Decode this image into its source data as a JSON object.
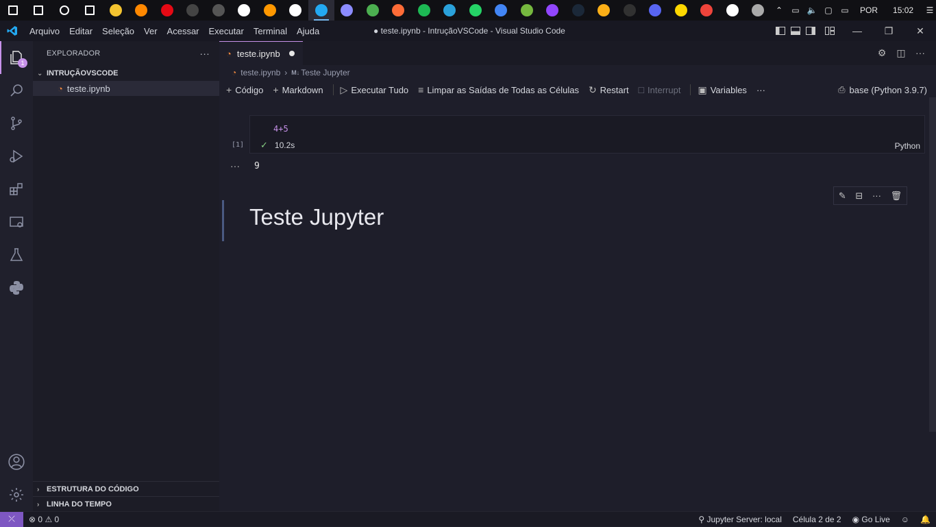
{
  "taskbar": {
    "apps": [
      {
        "name": "windows-start-icon",
        "color": "#ffffff"
      },
      {
        "name": "search-icon",
        "color": "#ffffff"
      },
      {
        "name": "cortana-icon",
        "color": "#ffffff"
      },
      {
        "name": "task-view-icon",
        "color": "#ffffff"
      },
      {
        "name": "file-explorer-icon",
        "color": "#f4c430"
      },
      {
        "name": "vlc-icon",
        "color": "#ff8800"
      },
      {
        "name": "netflix-icon",
        "color": "#e50914"
      },
      {
        "name": "terminal-icon",
        "color": "#444444"
      },
      {
        "name": "github-icon",
        "color": "#555555"
      },
      {
        "name": "pinwheel-icon",
        "color": "#ffffff"
      },
      {
        "name": "sublime-icon",
        "color": "#ff9800"
      },
      {
        "name": "notion-icon",
        "color": "#ffffff"
      },
      {
        "name": "vscode-icon",
        "color": "#23a9f2"
      },
      {
        "name": "app-icon",
        "color": "#8c8cff"
      },
      {
        "name": "shield-app-icon",
        "color": "#4caf50"
      },
      {
        "name": "postman-icon",
        "color": "#ff6c37"
      },
      {
        "name": "spotify-icon",
        "color": "#1db954"
      },
      {
        "name": "telegram-icon",
        "color": "#2aa1da"
      },
      {
        "name": "whatsapp-icon",
        "color": "#25d366"
      },
      {
        "name": "chrome-icon",
        "color": "#4285f4"
      },
      {
        "name": "utorrent-icon",
        "color": "#76b83f"
      },
      {
        "name": "twitch-icon",
        "color": "#9146ff"
      },
      {
        "name": "steam-icon",
        "color": "#1b2838"
      },
      {
        "name": "rockstar-icon",
        "color": "#fcaf17"
      },
      {
        "name": "epic-games-icon",
        "color": "#313131"
      },
      {
        "name": "discord-icon",
        "color": "#5865f2"
      },
      {
        "name": "sticky-notes-icon",
        "color": "#ffd800"
      },
      {
        "name": "anydesk-icon",
        "color": "#ef443b"
      },
      {
        "name": "store-icon",
        "color": "#ffffff"
      },
      {
        "name": "app-extra-icon",
        "color": "#aaaaaa"
      }
    ],
    "language": "POR",
    "clock": "15:02"
  },
  "titlebar": {
    "menu": [
      "Arquivo",
      "Editar",
      "Seleção",
      "Ver",
      "Acessar",
      "Executar",
      "Terminal",
      "Ajuda"
    ],
    "title": "● teste.ipynb - IntruçãoVSCode - Visual Studio Code"
  },
  "sidebar": {
    "header": "EXPLORADOR",
    "folder": "INTRUÇÃOVSCODE",
    "file": "teste.ipynb",
    "outline": "ESTRUTURA DO CÓDIGO",
    "timeline": "LINHA DO TEMPO"
  },
  "activity": {
    "badge": "1"
  },
  "editor": {
    "tab": "teste.ipynb",
    "breadcrumb": {
      "file": "teste.ipynb",
      "md_prefix": "M↓",
      "heading": "Teste Jupyter"
    },
    "toolbar": {
      "code": "Código",
      "markdown": "Markdown",
      "run_all": "Executar Tudo",
      "clear": "Limpar as Saídas de Todas as Células",
      "restart": "Restart",
      "interrupt": "Interrupt",
      "variables": "Variables",
      "more": "···",
      "kernel": "base (Python 3.9.7)"
    },
    "cell": {
      "exec_count": "[1]",
      "source": "4+5",
      "duration": "10.2s",
      "language": "Python",
      "output": "9"
    },
    "markdown_cell": {
      "heading": "Teste Jupyter"
    }
  },
  "statusbar": {
    "errors": "0",
    "warnings": "0",
    "jupyter": "Jupyter Server: local",
    "cell": "Célula 2 de 2",
    "golive": "Go Live"
  }
}
